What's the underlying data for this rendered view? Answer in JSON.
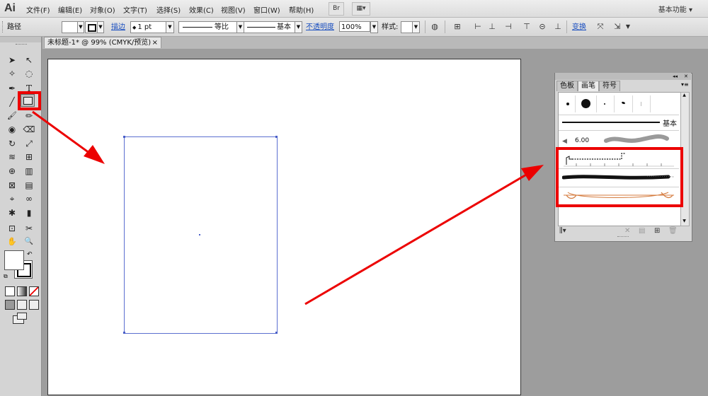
{
  "app": {
    "logo": "Ai",
    "workspace": "基本功能 ▾"
  },
  "menu": [
    "文件(F)",
    "编辑(E)",
    "对象(O)",
    "文字(T)",
    "选择(S)",
    "效果(C)",
    "视图(V)",
    "窗口(W)",
    "帮助(H)"
  ],
  "menubar_buttons": {
    "bridge": "Br",
    "arrange": "▦▾"
  },
  "control_bar": {
    "selection_label": "路径",
    "stroke_label": "描边",
    "stroke_weight": "1 pt",
    "profile_label": "等比",
    "brush_label": "基本",
    "opacity_label": "不透明度",
    "opacity_value": "100%",
    "style_label": "样式:",
    "transform_label": "变换"
  },
  "document_tab": {
    "title": "未标题-1* @ 99% (CMYK/预览)",
    "close": "×"
  },
  "brush_panel": {
    "tabs": [
      "色板",
      "画笔",
      "符号"
    ],
    "active_tab": "画笔",
    "collapse": "◂◂",
    "close": "✕",
    "basic_label": "基本",
    "size_value": "6.00"
  },
  "tools_icons": {
    "selection": "➤",
    "direct_selection": "↖",
    "magic_wand": "✧",
    "lasso": "◌",
    "pen": "✒",
    "type": "T",
    "line": "╱",
    "rectangle": "□",
    "paintbrush": "🖌",
    "pencil": "✏",
    "blob_brush": "◉",
    "eraser": "⌫",
    "rotate": "↻",
    "scale": "⤢",
    "warp": "≋",
    "free_transform": "⊞",
    "shape_builder": "⊕",
    "perspective": "▥",
    "mesh": "⊠",
    "gradient": "▤",
    "eyedropper": "⌖",
    "blend": "∞",
    "symbol_sprayer": "✱",
    "column_graph": "▮",
    "artboard": "⊡",
    "slice": "✂",
    "hand": "✋",
    "zoom": "🔍"
  },
  "colors": {
    "highlight": "#ec0000",
    "selection": "#5b6fd0",
    "brush_orange": "#d47a3c"
  }
}
